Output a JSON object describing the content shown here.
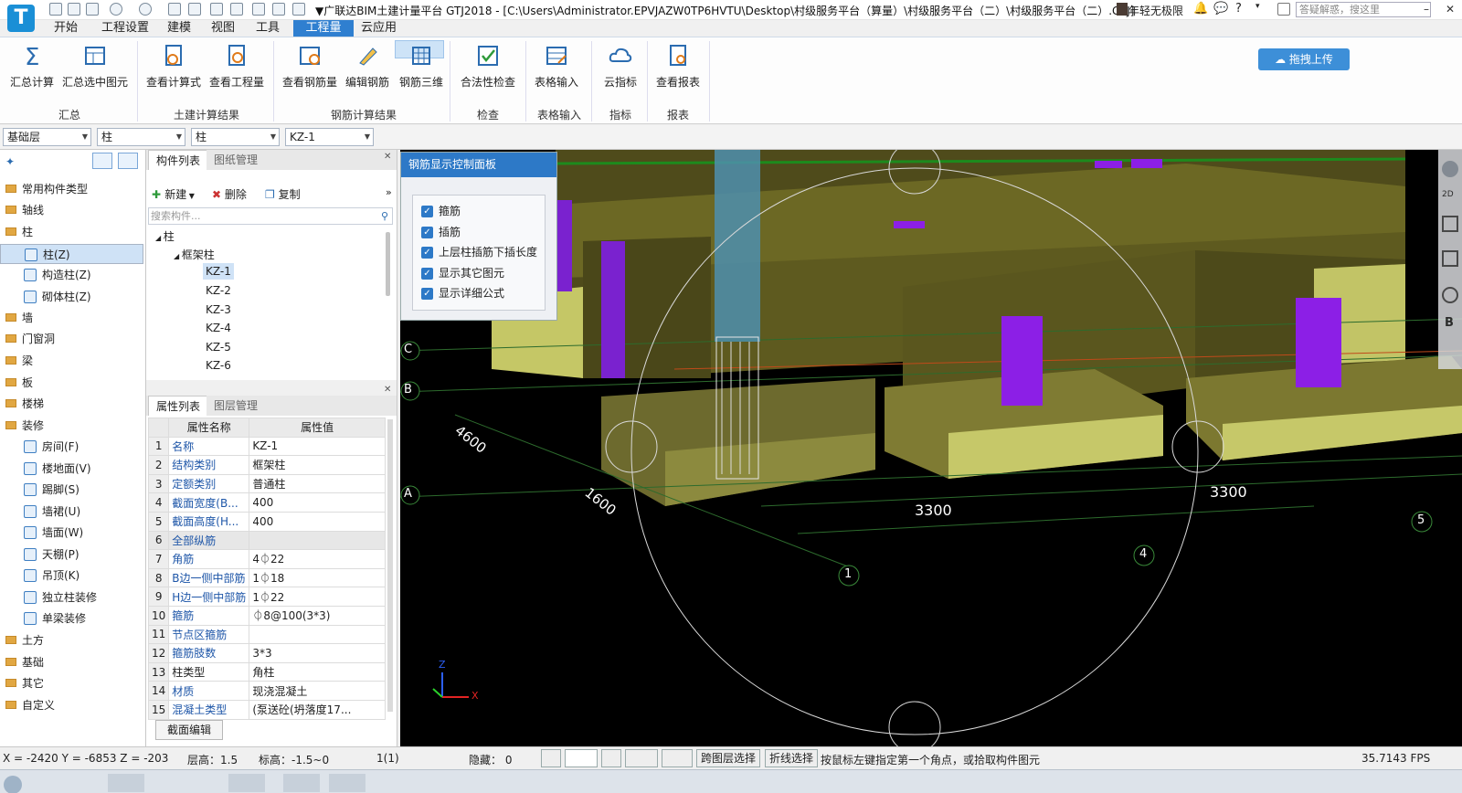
{
  "title_bar": {
    "logo_letter": "T",
    "title": "▼广联达BIM土建计量平台 GTJ2018 - [C:\\Users\\Administrator.EPVJAZW0TP6HVTU\\Desktop\\村级服务平台（算量）\\村级服务平台（二）\\村级服务平台（二）.GTJ]",
    "user_name": "年轻无极限",
    "help_label": "?",
    "search_placeholder": "答疑解惑，搜这里"
  },
  "menu_tabs": [
    "开始",
    "工程设置",
    "建模",
    "视图",
    "工具",
    "工程量",
    "云应用"
  ],
  "active_tab": "工程量",
  "ribbon": {
    "buttons": [
      "汇总计算",
      "汇总选中图元",
      "查看计算式",
      "查看工程量",
      "查看钢筋量",
      "编辑钢筋",
      "钢筋三维",
      "合法性检查",
      "表格输入",
      "云指标",
      "查看报表"
    ],
    "groups": [
      "汇总",
      "土建计算结果",
      "钢筋计算结果",
      "检查",
      "表格输入",
      "指标",
      "报表"
    ],
    "upload_label": "拖拽上传"
  },
  "selectors": [
    "基础层",
    "柱",
    "柱",
    "KZ-1"
  ],
  "left_nav": {
    "items": [
      "常用构件类型",
      "轴线",
      "柱",
      "柱(Z)",
      "构造柱(Z)",
      "砌体柱(Z)",
      "墙",
      "门窗洞",
      "梁",
      "板",
      "楼梯",
      "装修",
      "房间(F)",
      "楼地面(V)",
      "踢脚(S)",
      "墙裙(U)",
      "墙面(W)",
      "天棚(P)",
      "吊顶(K)",
      "独立柱装修",
      "单梁装修",
      "土方",
      "基础",
      "其它",
      "自定义"
    ],
    "selected": "柱(Z)"
  },
  "component_list": {
    "tabs": [
      "构件列表",
      "图纸管理"
    ],
    "toolbar": [
      "新建",
      "删除",
      "复制"
    ],
    "search_placeholder": "搜索构件...",
    "tree_root": "柱",
    "tree_group": "框架柱",
    "items": [
      "KZ-1",
      "KZ-2",
      "KZ-3",
      "KZ-4",
      "KZ-5",
      "KZ-6"
    ],
    "selected": "KZ-1"
  },
  "properties": {
    "tabs": [
      "属性列表",
      "图层管理"
    ],
    "headers": [
      "属性名称",
      "属性值"
    ],
    "rows": [
      {
        "n": "1",
        "name": "名称",
        "value": "KZ-1"
      },
      {
        "n": "2",
        "name": "结构类别",
        "value": "框架柱"
      },
      {
        "n": "3",
        "name": "定额类别",
        "value": "普通柱"
      },
      {
        "n": "4",
        "name": "截面宽度(B...",
        "value": "400"
      },
      {
        "n": "5",
        "name": "截面高度(H...",
        "value": "400"
      },
      {
        "n": "6",
        "name": "全部纵筋",
        "value": ""
      },
      {
        "n": "7",
        "name": "角筋",
        "value": "4⏀22"
      },
      {
        "n": "8",
        "name": "B边一侧中部筋",
        "value": "1⏀18"
      },
      {
        "n": "9",
        "name": "H边一侧中部筋",
        "value": "1⏀22"
      },
      {
        "n": "10",
        "name": "箍筋",
        "value": "⏀8@100(3*3)"
      },
      {
        "n": "11",
        "name": "节点区箍筋",
        "value": ""
      },
      {
        "n": "12",
        "name": "箍筋肢数",
        "value": "3*3"
      },
      {
        "n": "13",
        "name": "柱类型",
        "value": "角柱"
      },
      {
        "n": "14",
        "name": "材质",
        "value": "现浇混凝土"
      },
      {
        "n": "15",
        "name": "混凝土类型",
        "value": "(泵送砼(坍落度17..."
      }
    ],
    "section_edit_label": "截面编辑"
  },
  "rebar_panel": {
    "title": "钢筋显示控制面板",
    "options": [
      "箍筋",
      "插筋",
      "上层柱插筋下插长度",
      "显示其它图元",
      "显示详细公式"
    ]
  },
  "viewport": {
    "axis_labels": [
      "C",
      "B",
      "A",
      "1",
      "4",
      "5"
    ],
    "dimensions": [
      "4600",
      "1600",
      "3300",
      "3300"
    ],
    "coord_axes": [
      "Z",
      "X"
    ],
    "side_tools": [
      "2D",
      "B"
    ]
  },
  "status_bar": {
    "coords": "X = -2420 Y = -6853 Z = -203",
    "floor_height": "层高：1.5",
    "elevation": "标高：-1.5~0",
    "page": "1(1)",
    "hidden": "隐藏：  0",
    "cross_layer": "跨图层选择",
    "polyline": "折线选择",
    "hint": "按鼠标左键指定第一个角点，或拾取构件图元",
    "fps": "35.7143 FPS"
  }
}
